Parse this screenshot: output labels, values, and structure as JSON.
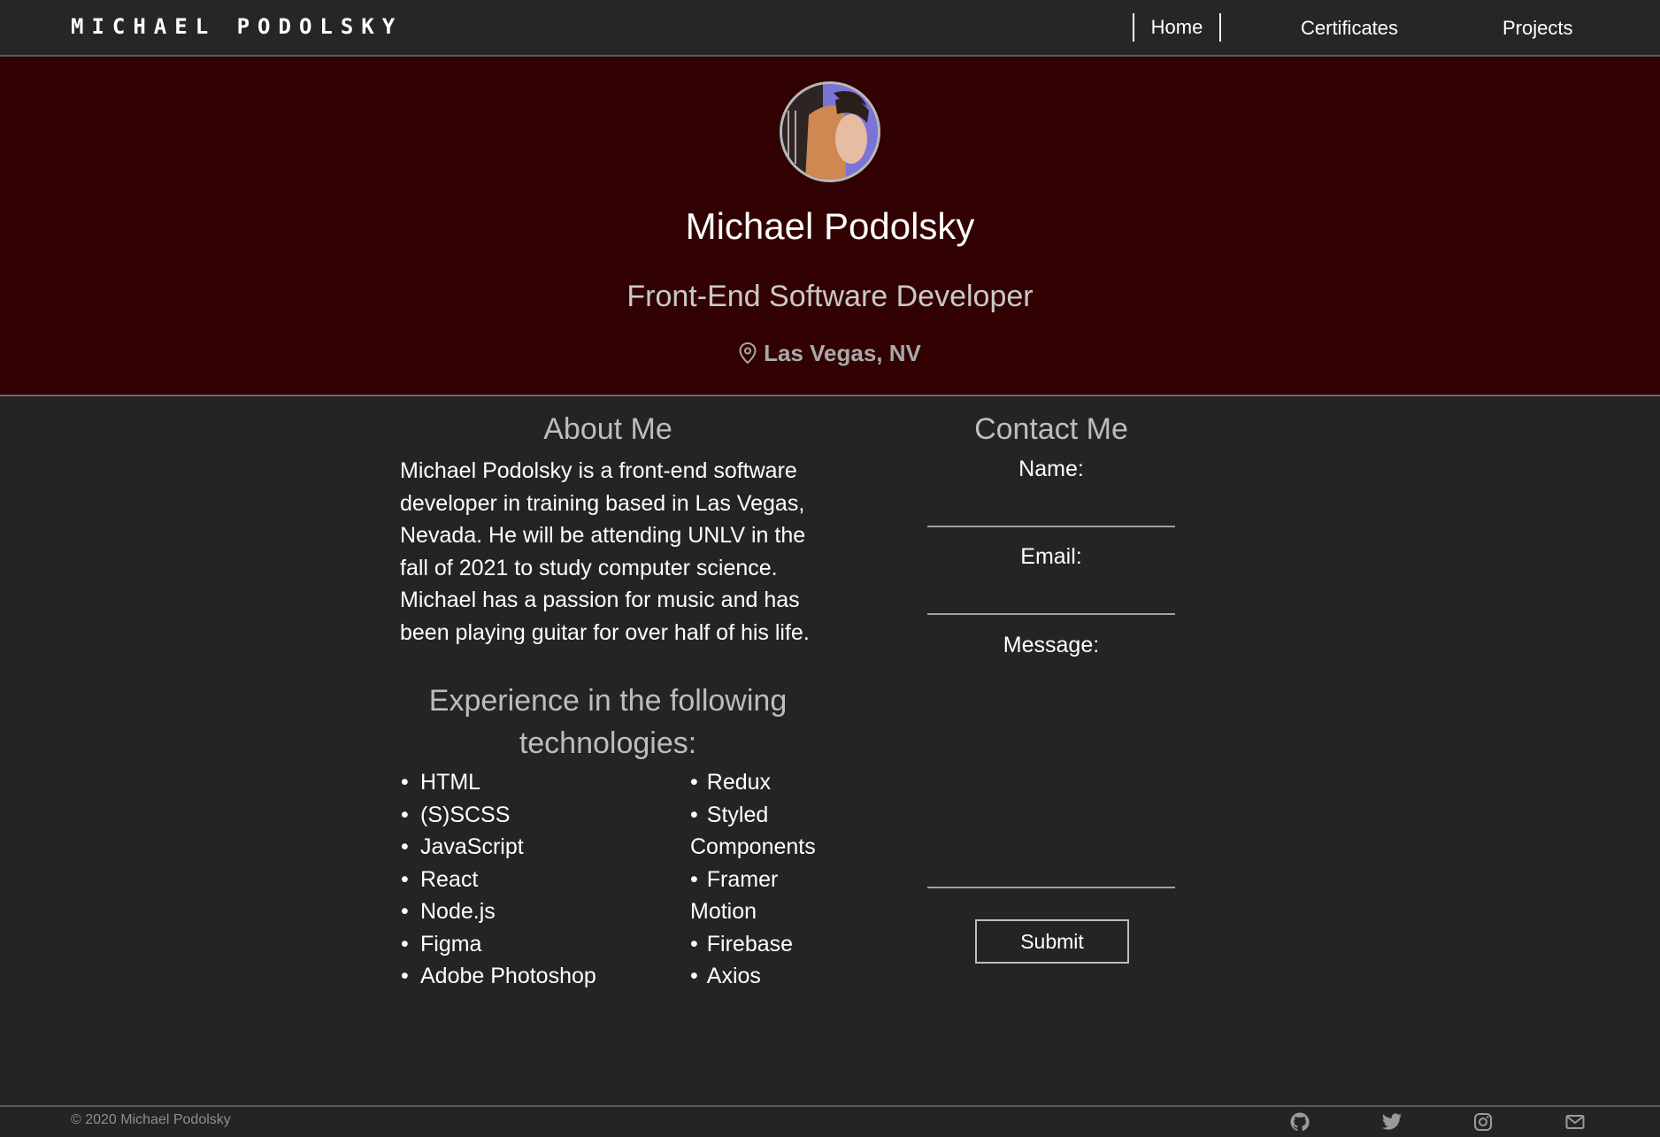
{
  "nav": {
    "brand": "MICHAEL PODOLSKY",
    "links": [
      "Home",
      "Certificates",
      "Projects"
    ]
  },
  "hero": {
    "name": "Michael Podolsky",
    "title": "Front-End Software Developer",
    "location": "Las Vegas, NV",
    "location_icon": "map-pin-icon"
  },
  "about": {
    "heading": "About Me",
    "paragraph": "Michael Podolsky is a front-end software developer in training based in Las Vegas, Nevada. He will be attending UNLV in the fall of 2021 to study computer science. Michael has a passion for music and has been playing guitar for over half of his life."
  },
  "experience": {
    "heading": "Experience in the following technologies:",
    "left": [
      "HTML",
      "(S)SCSS",
      "JavaScript",
      "React",
      "Node.js",
      "Figma",
      "Adobe Photoshop"
    ],
    "right": [
      "Redux",
      "Styled Components",
      "Framer Motion",
      "Firebase",
      "Axios"
    ]
  },
  "contact": {
    "heading": "Contact Me",
    "name_label": "Name:",
    "email_label": "Email:",
    "message_label": "Message:",
    "name_value": "",
    "email_value": "",
    "message_value": "",
    "submit_label": "Submit"
  },
  "footer": {
    "copyright": "© 2020 Michael Podolsky",
    "social_icons": [
      "github-icon",
      "twitter-icon",
      "instagram-icon",
      "mail-icon"
    ]
  },
  "colors": {
    "hero_bg": "#320102",
    "page_bg": "#242424",
    "nav_bg": "#262626"
  }
}
